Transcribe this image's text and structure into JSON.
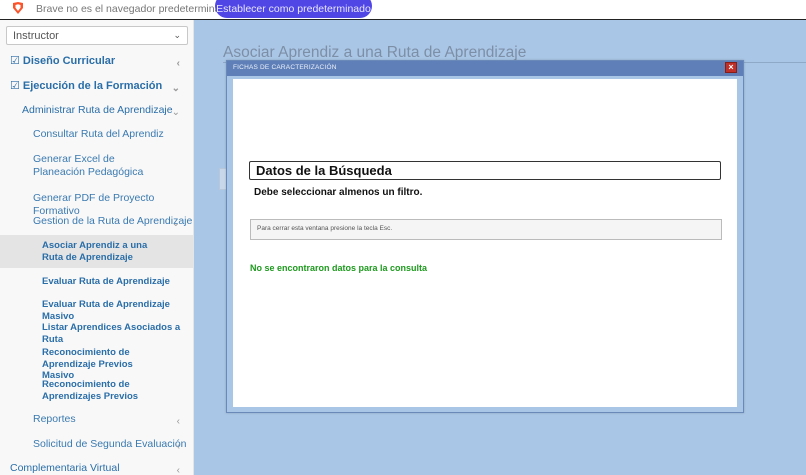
{
  "browser_bar": {
    "message": "Brave no es el navegador predeterminado",
    "default_button": "Establecer como predeterminado",
    "accent_color": "#4f46e5"
  },
  "sidebar": {
    "role_select": {
      "value": "Instructor"
    },
    "menu": [
      {
        "label": "Diseño Curricular",
        "icon": "edit-icon",
        "chevron": "‹"
      },
      {
        "label": "Ejecución de la Formación",
        "icon": "edit-icon",
        "chevron": "⌄"
      },
      {
        "label": "Administrar Ruta de Aprendizaje",
        "chevron": "⌄"
      },
      {
        "label": "Consultar Ruta del Aprendiz"
      },
      {
        "label": "Generar Excel de Planeación Pedagógica"
      },
      {
        "label": "Generar PDF de Proyecto Formativo"
      },
      {
        "label": "Gestion de la Ruta de Aprendizaje",
        "chevron": "⌄"
      },
      {
        "label": "Asociar Aprendiz a una Ruta de Aprendizaje",
        "active": true
      },
      {
        "label": "Evaluar Ruta de Aprendizaje"
      },
      {
        "label": "Evaluar Ruta de Aprendizaje Masivo"
      },
      {
        "label": "Listar Aprendices Asociados a Ruta"
      },
      {
        "label": "Reconocimiento de Aprendizaje Previos Masivo"
      },
      {
        "label": "Reconocimiento de Aprendizajes Previos"
      },
      {
        "label": "Reportes",
        "chevron": "‹"
      },
      {
        "label": "Solicitud de Segunda Evaluación",
        "chevron": "‹"
      },
      {
        "label": "Complementaria Virtual",
        "chevron": "‹"
      }
    ]
  },
  "main": {
    "page_title": "Asociar Aprendiz a una Ruta de Aprendizaje"
  },
  "modal": {
    "header_title": "FICHAS DE CARACTERIZACIÓN",
    "close_label": "×",
    "search_title": "Datos de la Búsqueda",
    "filter_message": "Debe seleccionar almenos un filtro.",
    "esc_note": "Para cerrar esta ventana presione la tecla Esc.",
    "no_data": "No se encontraron datos para la consulta",
    "colors": {
      "header": "#5e7fb8",
      "close": "#c0302b",
      "no_data": "#1d9a1d"
    }
  }
}
